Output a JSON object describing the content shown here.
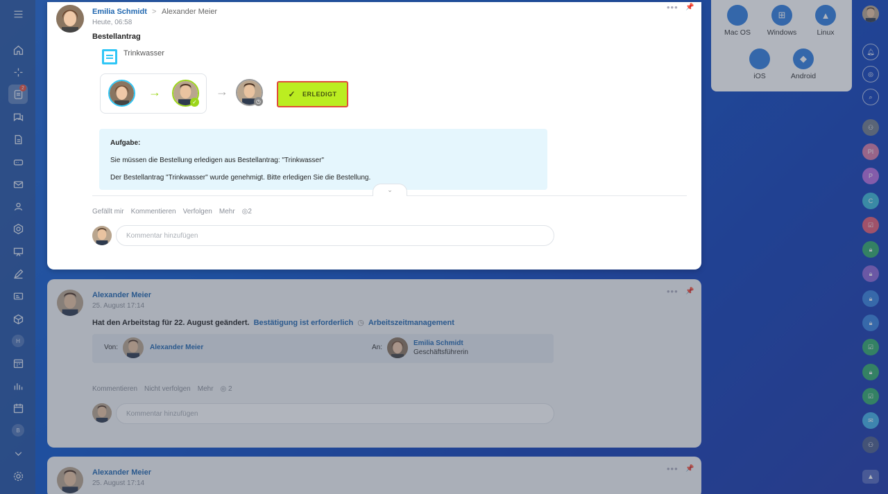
{
  "post1": {
    "author": "Emilia Schmidt",
    "separator": ">",
    "target": "Alexander Meier",
    "time": "Heute, 06:58",
    "title": "Bestellantrag",
    "doc_label": "Trinkwasser",
    "status_button": "ERLEDIGT",
    "task": {
      "heading": "Aufgabe:",
      "line1": "Sie müssen die Bestellung erledigen aus Bestellantrag: \"Trinkwasser\"",
      "line2": "Der Bestellantrag \"Trinkwasser\" wurde genehmigt. Bitte erledigen Sie die Bestellung."
    },
    "actions": {
      "like": "Gefällt mir",
      "comment": "Kommentieren",
      "follow": "Verfolgen",
      "more": "Mehr",
      "views": "2"
    },
    "comment_placeholder": "Kommentar hinzufügen"
  },
  "post2": {
    "author": "Alexander Meier",
    "time": "25. August 17:14",
    "text": "Hat den Arbeitstag für 22. August geändert.",
    "confirm_link": "Bestätigung ist erforderlich",
    "module_link": "Arbeitszeitmanagement",
    "from_label": "Von:",
    "from_name": "Alexander Meier",
    "to_label": "An:",
    "to_name": "Emilia Schmidt",
    "to_role": "Geschäftsführerin",
    "actions": {
      "comment": "Kommentieren",
      "unfollow": "Nicht verfolgen",
      "more": "Mehr",
      "views": "2"
    },
    "comment_placeholder": "Kommentar hinzufügen"
  },
  "post3": {
    "author": "Alexander Meier",
    "time": "25. August 17:14"
  },
  "downloads": {
    "items": [
      {
        "label": "Mac OS",
        "icon": "apple-icon"
      },
      {
        "label": "Windows",
        "icon": "windows-icon"
      },
      {
        "label": "Linux",
        "icon": "linux-icon"
      },
      {
        "label": "iOS",
        "icon": "apple-icon"
      },
      {
        "label": "Android",
        "icon": "android-icon"
      }
    ]
  },
  "left_sidebar": {
    "badge_count": "2",
    "letter_h": "H",
    "letter_b": "B"
  },
  "right_bar": {
    "letters": [
      "PI",
      "P",
      "C"
    ]
  },
  "colors": {
    "accent_link": "#2067b0",
    "done_button": "#bbed21",
    "task_bg": "#e5f6fd",
    "doc_icon": "#2fc6f6"
  }
}
